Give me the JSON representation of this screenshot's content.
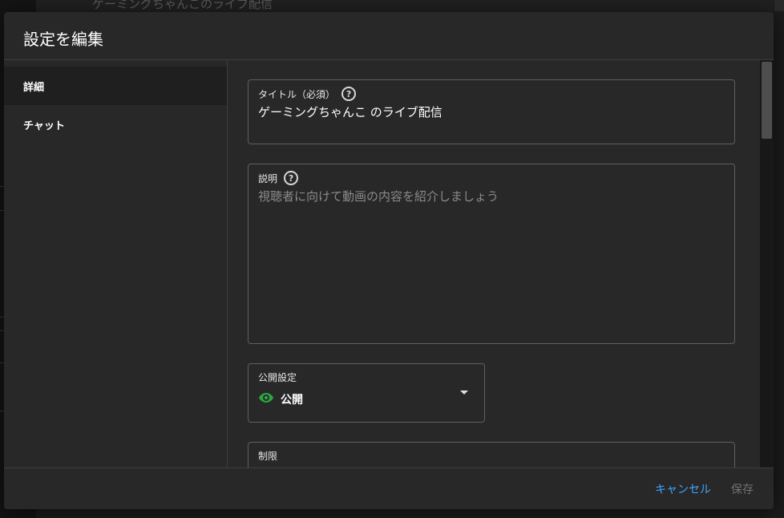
{
  "background": {
    "page_title": "ゲーミングちゃんこのライブ配信"
  },
  "dialog": {
    "title": "設定を編集"
  },
  "sidebar": {
    "items": [
      {
        "label": "詳細",
        "active": true
      },
      {
        "label": "チャット",
        "active": false
      }
    ]
  },
  "form": {
    "title_field": {
      "label": "タイトル（必須）",
      "value": "ゲーミングちゃんこ のライブ配信",
      "help_icon": "?"
    },
    "description_field": {
      "label": "説明",
      "placeholder": "視聴者に向けて動画の内容を紹介しましょう",
      "help_icon": "?"
    },
    "visibility_field": {
      "label": "公開設定",
      "value": "公開",
      "icon": "eye-icon",
      "icon_color": "#2ba640"
    },
    "restriction_field": {
      "label": "制限"
    }
  },
  "footer": {
    "cancel_label": "キャンセル",
    "save_label": "保存",
    "accent_color": "#3ea6ff"
  }
}
